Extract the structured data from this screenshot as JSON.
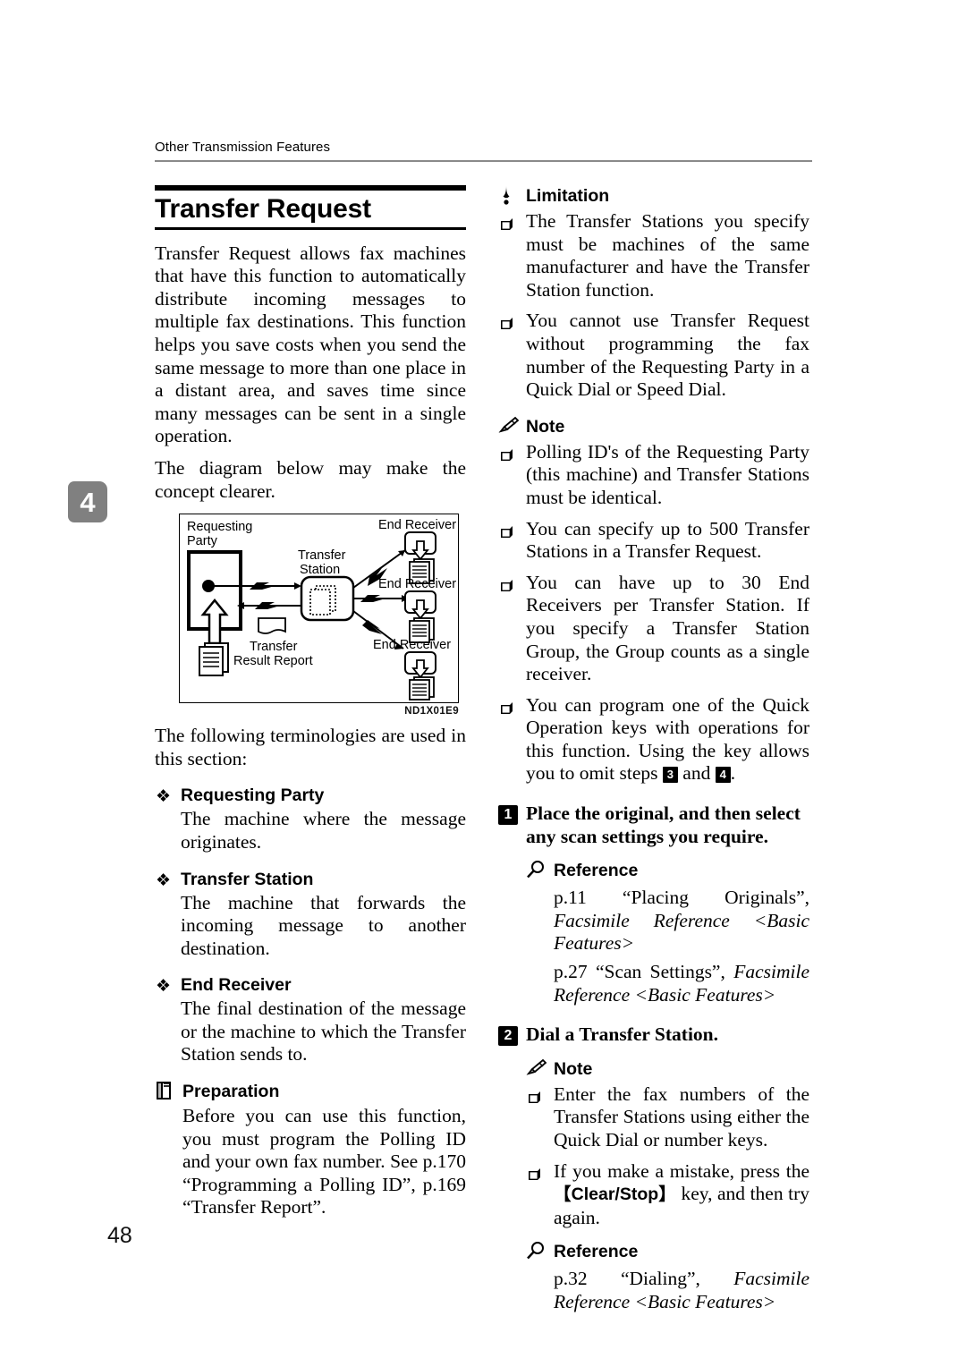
{
  "page": {
    "running_header": "Other Transmission Features",
    "chapter_tab": "4",
    "folio": "48"
  },
  "section": {
    "title": "Transfer Request",
    "intro": "Transfer Request allows fax machines that have this function to automatically distribute incoming messages to multiple fax destinations. This function helps you save costs when you send the same message to more than one place in a distant area, and saves time since many messages can be sent in a single operation.",
    "diagram_lead": "The diagram below may make the concept clearer.",
    "terminology_lead": "The following terminologies are used in this section:"
  },
  "figure": {
    "code": "ND1X01E9",
    "labels": {
      "requesting_party": "Requesting",
      "requesting_party_2": "Party",
      "transfer_station": "Transfer",
      "transfer_station_2": "Station",
      "end_receiver_1": "End Receiver",
      "end_receiver_2": "End Receiver",
      "end_receiver_3": "End Receiver",
      "transfer_result_report": "Transfer",
      "transfer_result_report_2": "Result Report"
    }
  },
  "terms": [
    {
      "bullet": "❖",
      "label": "Requesting Party",
      "body": "The machine where the message originates."
    },
    {
      "bullet": "❖",
      "label": "Transfer Station",
      "body": "The machine that forwards the incoming message to another destination."
    },
    {
      "bullet": "❖",
      "label": "End Receiver",
      "body": "The final destination of the message or the machine to which the Transfer Station sends to."
    }
  ],
  "preparation": {
    "icon": "book-icon",
    "label": "Preparation",
    "body": "Before you can use this function, you must program the Polling ID and your own fax number. See p.170 “Programming a Polling ID”, p.169 “Transfer Report”."
  },
  "limitation": {
    "icon": "exclamation-drop-icon",
    "label": "Limitation",
    "items": [
      "The Transfer Stations you specify must be machines of the same manufacturer and have the Transfer Station function.",
      "You cannot use Transfer Request without programming the fax number of the Requesting Party in a Quick Dial or Speed Dial."
    ]
  },
  "note_top": {
    "icon": "pencil-icon",
    "label": "Note",
    "items": [
      "Polling ID's of the Requesting Party (this machine) and Transfer Stations must be identical.",
      "You can specify up to 500 Transfer Stations in a Transfer Request.",
      "You can have up to 30 End Receivers per Transfer Station. If you specify a Transfer Station Group, the Group counts as a single receiver."
    ],
    "last_item_prefix": "You can program one of the Quick Operation keys with operations for this function. Using the key allows you to omit steps ",
    "last_item_step_a": "3",
    "last_item_mid": " and ",
    "last_item_step_b": "4",
    "last_item_suffix": "."
  },
  "steps": [
    {
      "number": "1",
      "text": "Place the original, and then select any scan settings you require.",
      "reference": {
        "icon": "magnifier-icon",
        "label": "Reference",
        "entries": [
          {
            "plain": "p.11 “Placing Originals”, ",
            "italic": "Facsimile Reference <Basic Features>"
          },
          {
            "plain": "p.27 “Scan Settings”, ",
            "italic": "Facsimile Reference <Basic Features>"
          }
        ]
      }
    },
    {
      "number": "2",
      "text": "Dial a Transfer Station.",
      "note": {
        "icon": "pencil-icon",
        "label": "Note",
        "items": [
          {
            "plain_before": "Enter the fax numbers of the Transfer Stations using either the Quick Dial or number keys.",
            "key": "",
            "plain_after": ""
          },
          {
            "plain_before": "If you make a mistake, press the ",
            "key": "【Clear/Stop】",
            "plain_after": " key, and then try again."
          }
        ]
      },
      "reference": {
        "icon": "magnifier-icon",
        "label": "Reference",
        "entries": [
          {
            "plain": "p.32 “Dialing”, ",
            "italic": "Facsimile Reference <Basic Features>"
          }
        ]
      }
    }
  ],
  "colors": {
    "chapter_tab_bg": "#808080",
    "rule": "#8a8a8a",
    "ink": "#000000"
  }
}
